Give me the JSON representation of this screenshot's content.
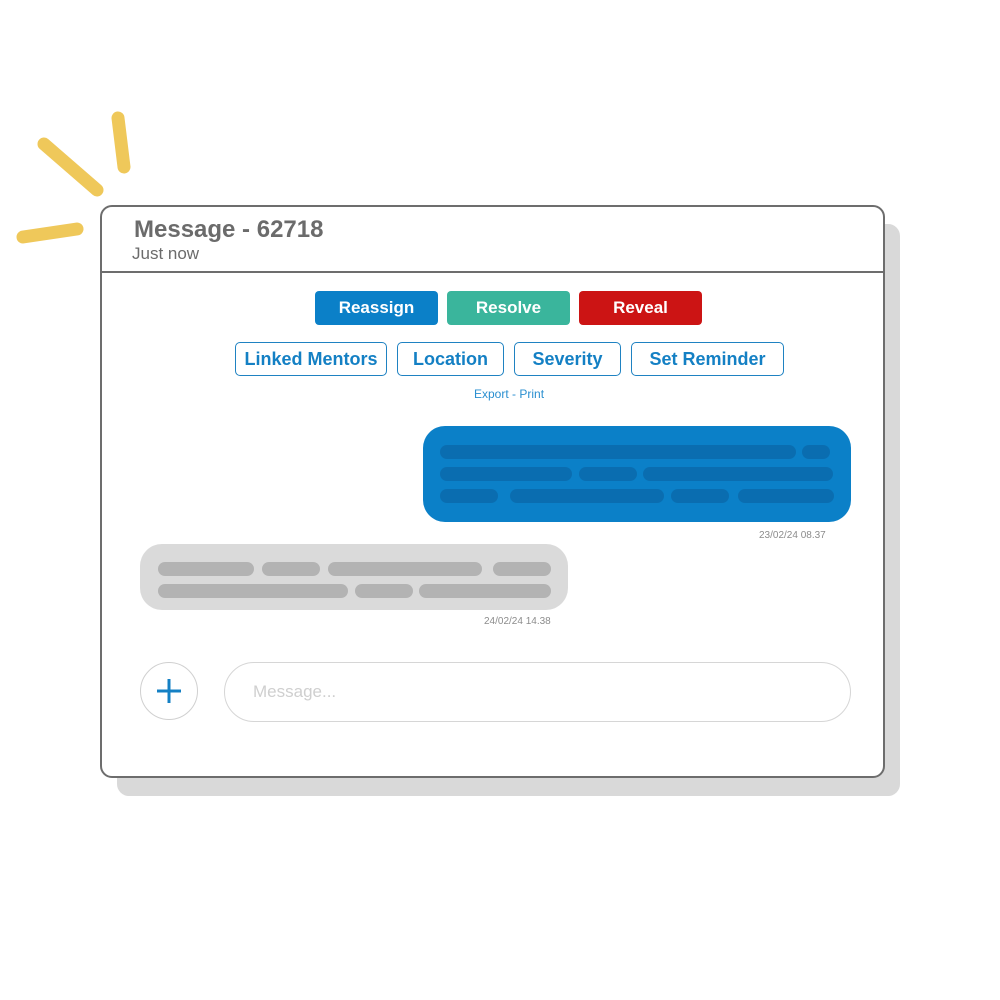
{
  "header": {
    "title": "Message - 62718",
    "subtitle": "Just now"
  },
  "actions": [
    {
      "label": "Reassign",
      "color": "#0b80c8"
    },
    {
      "label": "Resolve",
      "color": "#3ab59c"
    },
    {
      "label": "Reveal",
      "color": "#cc1414"
    }
  ],
  "filters": [
    "Linked Mentors",
    "Location",
    "Severity",
    "Set Reminder"
  ],
  "export_links": {
    "export_label": "Export",
    "separator": " - ",
    "print_label": "Print"
  },
  "messages": [
    {
      "direction": "outgoing",
      "timestamp": "23/02/24 08.37",
      "bubble_color": "#0b80c8"
    },
    {
      "direction": "incoming",
      "timestamp": "24/02/24 14.38",
      "bubble_color": "#dadada"
    }
  ],
  "composer": {
    "placeholder": "Message...",
    "add_icon": "plus-icon"
  },
  "colors": {
    "accent": "#1480c4",
    "decoration": "#efc85a"
  }
}
